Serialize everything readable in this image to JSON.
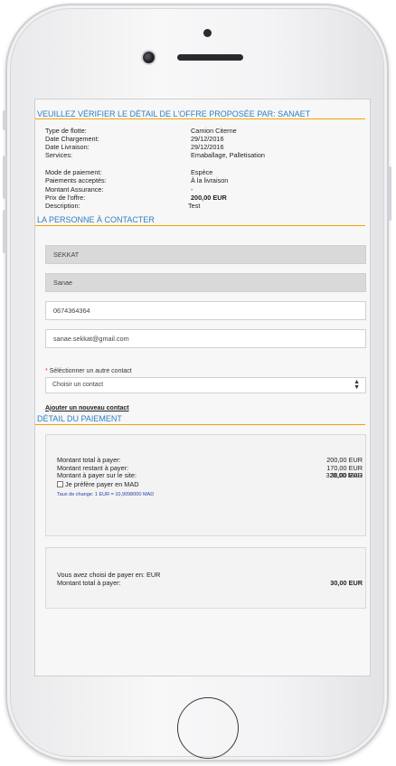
{
  "offer": {
    "title": "VEUILLEZ VÉRIFIER LE DÉTAIL DE L'OFFRE PROPOSÉE PAR: SANAET",
    "rows_a": [
      {
        "label": "Type de flotte:",
        "value": "Camion Citerne"
      },
      {
        "label": "Date Chargement:",
        "value": "29/12/2016"
      },
      {
        "label": "Date Livraison:",
        "value": "29/12/2016"
      },
      {
        "label": "Services:",
        "value": "Emaballage, Palletisation"
      }
    ],
    "rows_b": [
      {
        "label": "Mode de paiement:",
        "value": "Espèce"
      },
      {
        "label": "Paiements acceptés:",
        "value": "À la livraison"
      },
      {
        "label": "Montant Assurance:",
        "value": "-"
      },
      {
        "label": "Prix de l'offre:",
        "value": "200,00 EUR"
      },
      {
        "label": "Description:",
        "value": "Test"
      }
    ]
  },
  "contact": {
    "title": "LA PERSONNE À CONTACTER",
    "last_name": "SEKKAT",
    "first_name": "Sanae",
    "phone": "0674364364",
    "email": "sanae.sekkat@gmail.com",
    "select_label_star": "*",
    "select_label": "Séléctionner un autre contact",
    "select_value": "Choisir un contact",
    "add_link": "Ajouter un nouveau contact"
  },
  "payment": {
    "title": "DÉTAIL DU PAIEMENT",
    "rows": [
      {
        "label": "Montant total à payer:",
        "value": "200,00 EUR"
      },
      {
        "label": "Montant restant à payer:",
        "value": "170,00 EUR"
      },
      {
        "label": "Montant à payer sur le site:",
        "value": "30,00 EUR"
      }
    ],
    "checkbox_label": "Je préfère payer en MAD",
    "checkbox_value": "328,00 MAD",
    "checkbox_checked": false,
    "rate": "Taux de change: 1 EUR = 10,9098000 MAD",
    "chosen_currency": "Vous avez choisi de payer en: EUR",
    "total_label": "Montant total à payer:",
    "total_value": "30,00 EUR"
  },
  "colors": {
    "title_blue": "#2f7fc1",
    "accent_orange": "#f0a500"
  }
}
